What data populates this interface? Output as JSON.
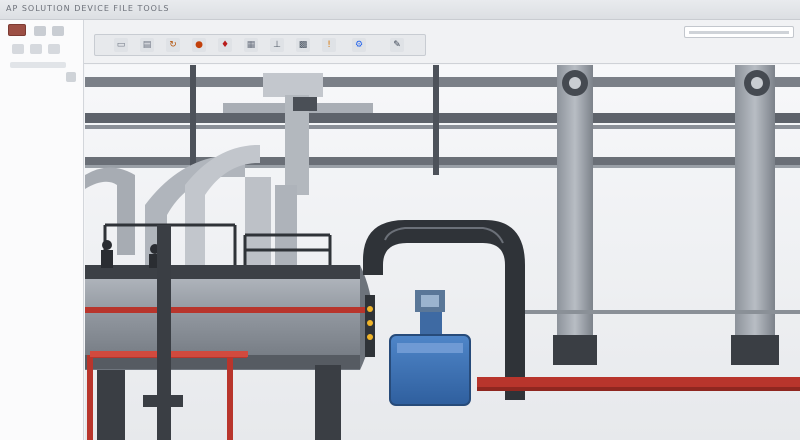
{
  "app": {
    "title": "AP SOLUTION DEVICE FILE TOOLS"
  },
  "left_panel": {
    "items": [
      "",
      "",
      "",
      "",
      ""
    ]
  },
  "toolbar": {
    "tools": [
      {
        "icon": "select-tool-icon",
        "glyph": "▭",
        "color": "#6b7280"
      },
      {
        "icon": "layer-tool-icon",
        "glyph": "▤",
        "color": "#6b7280"
      },
      {
        "icon": "rotate-tool-icon",
        "glyph": "↻",
        "color": "#b45309"
      },
      {
        "icon": "paint-tool-icon",
        "glyph": "●",
        "color": "#c2410c"
      },
      {
        "icon": "fire-tool-icon",
        "glyph": "♦",
        "color": "#b91c1c"
      },
      {
        "icon": "table-tool-icon",
        "glyph": "▦",
        "color": "#6b7280"
      },
      {
        "icon": "measure-tool-icon",
        "glyph": "⊥",
        "color": "#4b5563"
      },
      {
        "icon": "grid-tool-icon",
        "glyph": "▩",
        "color": "#4b5563"
      },
      {
        "icon": "alert-tool-icon",
        "glyph": "!",
        "color": "#d97706"
      },
      {
        "icon": "robot-arm-tool-icon",
        "glyph": "⚙",
        "color": "#2563eb"
      },
      {
        "icon": "wrench-tool-icon",
        "glyph": "✎",
        "color": "#374151"
      }
    ],
    "search": {
      "placeholder": ""
    }
  },
  "colors": {
    "pipe": "#5c6169",
    "pipe_dark": "#3b3f45",
    "accent_red": "#b8352c",
    "device_blue": "#3d73b8",
    "background": "#f3f4f6"
  }
}
